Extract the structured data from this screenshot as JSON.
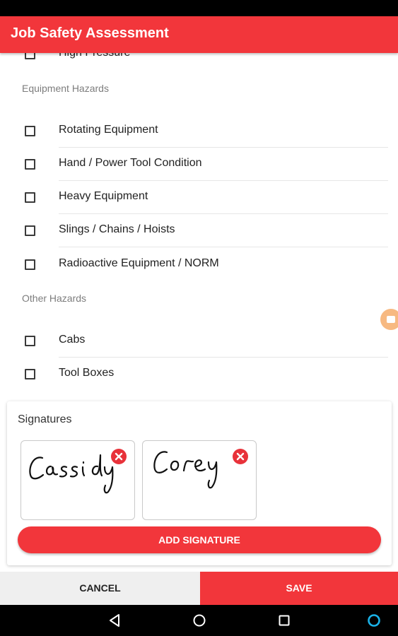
{
  "app": {
    "title": "Job Safety Assessment"
  },
  "checklist": {
    "partial_item": "High Pressure",
    "sections": [
      {
        "title": "Equipment Hazards",
        "items": [
          {
            "label": "Rotating Equipment",
            "checked": false
          },
          {
            "label": "Hand / Power Tool Condition",
            "checked": false
          },
          {
            "label": "Heavy Equipment",
            "checked": false
          },
          {
            "label": "Slings / Chains / Hoists",
            "checked": false
          },
          {
            "label": "Radioactive Equipment / NORM",
            "checked": false
          }
        ]
      },
      {
        "title": "Other Hazards",
        "items": [
          {
            "label": "Cabs",
            "checked": false
          },
          {
            "label": "Tool Boxes",
            "checked": false
          }
        ]
      }
    ]
  },
  "signatures": {
    "title": "Signatures",
    "items": [
      {
        "name": "Cassidy"
      },
      {
        "name": "Corey"
      }
    ],
    "add_label": "ADD SIGNATURE"
  },
  "actions": {
    "cancel_label": "CANCEL",
    "save_label": "SAVE"
  },
  "colors": {
    "primary": "#f2363b",
    "remove": "#e8323a",
    "accent_circle": "#1ab2e8"
  }
}
